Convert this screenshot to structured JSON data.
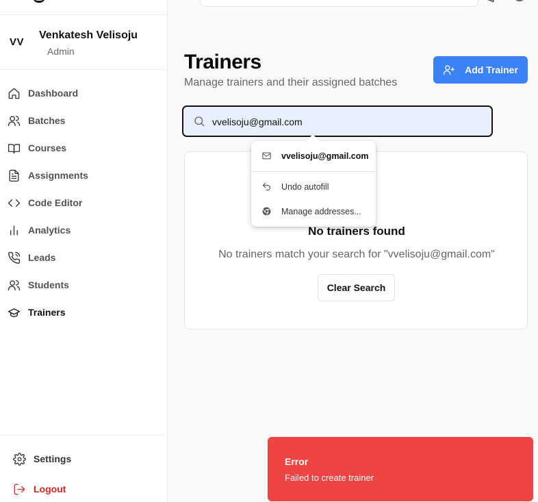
{
  "profile": {
    "initials": "VV",
    "name": "Venkatesh Velisoju",
    "role": "Admin"
  },
  "sidebar": {
    "items": [
      {
        "label": "Dashboard",
        "icon": "home-icon"
      },
      {
        "label": "Batches",
        "icon": "users-icon"
      },
      {
        "label": "Courses",
        "icon": "book-icon"
      },
      {
        "label": "Assignments",
        "icon": "file-text-icon"
      },
      {
        "label": "Code Editor",
        "icon": "code-icon"
      },
      {
        "label": "Analytics",
        "icon": "bar-chart-icon"
      },
      {
        "label": "Leads",
        "icon": "phone-icon"
      },
      {
        "label": "Students",
        "icon": "users-icon"
      },
      {
        "label": "Trainers",
        "icon": "graduation-cap-icon",
        "active": true
      }
    ],
    "settings_label": "Settings",
    "logout_label": "Logout"
  },
  "header": {
    "title": "Trainers",
    "subtitle": "Manage trainers and their assigned batches",
    "add_button_label": "Add Trainer"
  },
  "search": {
    "value": "vvelisoju@gmail.com"
  },
  "autofill": {
    "email": "vvelisoju@gmail.com",
    "undo_label": "Undo autofill",
    "manage_label": "Manage addresses..."
  },
  "empty_state": {
    "title": "No trainers found",
    "message": "No trainers match your search for \"vvelisoju@gmail.com\"",
    "clear_label": "Clear Search"
  },
  "toast": {
    "title": "Error",
    "description": "Failed to create trainer"
  },
  "colors": {
    "primary": "#3b82f6",
    "error": "#ef4444",
    "logout": "#dc2626"
  }
}
